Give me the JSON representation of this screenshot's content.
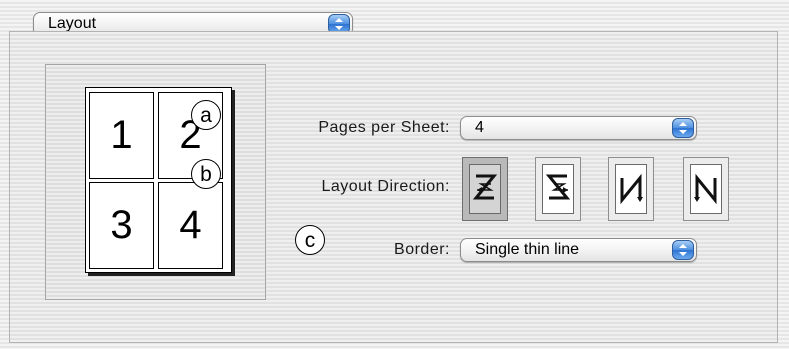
{
  "header": {
    "pane_popup_value": "Layout"
  },
  "preview": {
    "pages": [
      "1",
      "2",
      "3",
      "4"
    ]
  },
  "callouts": [
    "a",
    "b",
    "c"
  ],
  "settings": {
    "pages_per_sheet_label": "Pages per Sheet:",
    "pages_per_sheet_value": "4",
    "layout_direction_label": "Layout Direction:",
    "layout_direction_options": [
      {
        "icon": "z-order-left-to-right-icon",
        "selected": true
      },
      {
        "icon": "reverse-z-order-right-to-left-icon",
        "selected": false
      },
      {
        "icon": "n-order-top-to-bottom-icon",
        "selected": false
      },
      {
        "icon": "reverse-n-order-icon",
        "selected": false
      }
    ],
    "border_label": "Border:",
    "border_value": "Single thin line"
  },
  "colors": {
    "accent_blue": "#4d8fe0",
    "selected_button": "#b9b9b9"
  }
}
